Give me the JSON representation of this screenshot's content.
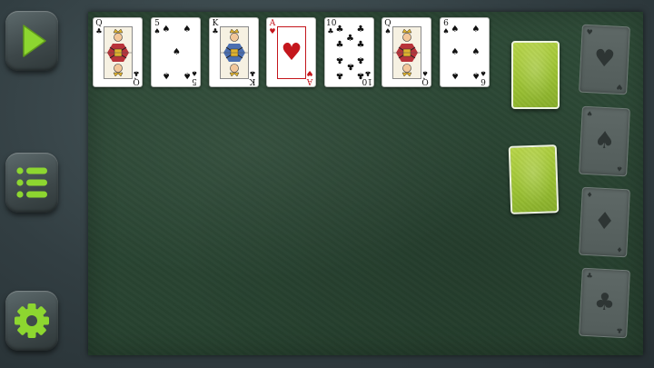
{
  "toolbar": {
    "play_icon": "play-icon",
    "menu_icon": "list-menu-icon",
    "settings_icon": "gear-icon",
    "accent_color": "#8dd630"
  },
  "tableau": [
    {
      "rank": "Q",
      "suit": "♣",
      "color": "black",
      "type": "face"
    },
    {
      "rank": "5",
      "suit": "♠",
      "color": "black",
      "type": "pips",
      "count": 5
    },
    {
      "rank": "K",
      "suit": "♣",
      "color": "black",
      "type": "face"
    },
    {
      "rank": "A",
      "suit": "♥",
      "color": "red",
      "type": "ace"
    },
    {
      "rank": "10",
      "suit": "♣",
      "color": "black",
      "type": "pips",
      "count": 10
    },
    {
      "rank": "Q",
      "suit": "♠",
      "color": "black",
      "type": "face"
    },
    {
      "rank": "6",
      "suit": "♠",
      "color": "black",
      "type": "pips",
      "count": 6
    }
  ],
  "foundations": [
    {
      "suit": "♥",
      "name": "hearts"
    },
    {
      "suit": "♠",
      "name": "spades"
    },
    {
      "suit": "♦",
      "name": "diamonds"
    },
    {
      "suit": "♣",
      "name": "clubs"
    }
  ],
  "colors": {
    "felt": "#2b4634",
    "card_back": "#9cc233",
    "red_suit": "#c4161c"
  }
}
